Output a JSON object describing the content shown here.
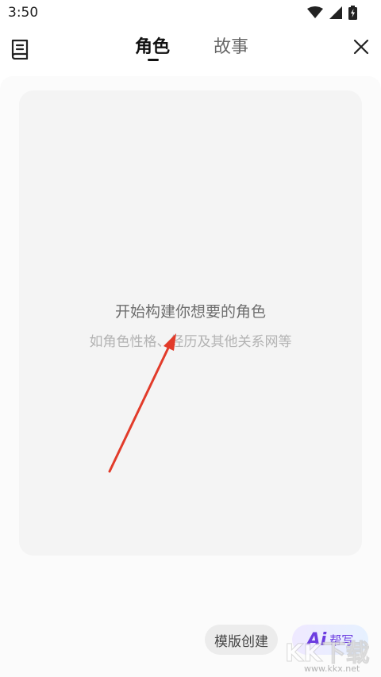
{
  "status_bar": {
    "time": "3:50",
    "icons": [
      "wifi-icon",
      "cellular-signal-icon",
      "battery-charging-icon"
    ]
  },
  "header": {
    "left_icon": "book-icon",
    "tabs": [
      {
        "label": "角色",
        "active": true
      },
      {
        "label": "故事",
        "active": false
      }
    ],
    "close_icon": "close-icon"
  },
  "empty_state": {
    "title": "开始构建你想要的角色",
    "subtitle": "如角色性格、经历及其他关系网等"
  },
  "annotation": {
    "arrow_color": "#e23b2a"
  },
  "bottom_actions": {
    "template_label": "模版创建",
    "ai_logo": "Ai",
    "ai_label": "帮写"
  },
  "watermark": {
    "text": "KK下载",
    "url": "www.kkx.net"
  },
  "colors": {
    "accent": "#6c3de0",
    "card_bg": "#f4f4f4"
  }
}
